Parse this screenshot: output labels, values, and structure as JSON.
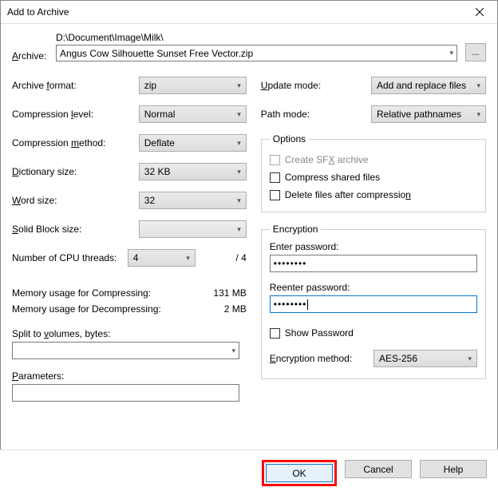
{
  "window": {
    "title": "Add to Archive"
  },
  "archive": {
    "label": "Archive:",
    "path": "D:\\Document\\Image\\Milk\\",
    "filename": "Angus Cow Silhouette Sunset Free Vector.zip",
    "browse": "..."
  },
  "left": {
    "format_label": "Archive format:",
    "format_value": "zip",
    "level_label": "Compression level:",
    "level_value": "Normal",
    "method_label": "Compression method:",
    "method_value": "Deflate",
    "dict_label": "Dictionary size:",
    "dict_value": "32 KB",
    "word_label": "Word size:",
    "word_value": "32",
    "block_label": "Solid Block size:",
    "block_value": "",
    "threads_label": "Number of CPU threads:",
    "threads_value": "4",
    "threads_total": "/ 4",
    "mem_comp_label": "Memory usage for Compressing:",
    "mem_comp_value": "131 MB",
    "mem_decomp_label": "Memory usage for Decompressing:",
    "mem_decomp_value": "2 MB",
    "split_label": "Split to volumes, bytes:",
    "params_label": "Parameters:"
  },
  "right": {
    "update_label": "Update mode:",
    "update_value": "Add and replace files",
    "pathmode_label": "Path mode:",
    "pathmode_value": "Relative pathnames",
    "options_legend": "Options",
    "opt_sfx": "Create SFX archive",
    "opt_shared": "Compress shared files",
    "opt_delete": "Delete files after compression",
    "enc_legend": "Encryption",
    "enter_pwd": "Enter password:",
    "reenter_pwd": "Reenter password:",
    "pwd_mask": "••••••••",
    "show_pwd": "Show Password",
    "enc_method_label": "Encryption method:",
    "enc_method_value": "AES-256"
  },
  "buttons": {
    "ok": "OK",
    "cancel": "Cancel",
    "help": "Help"
  }
}
